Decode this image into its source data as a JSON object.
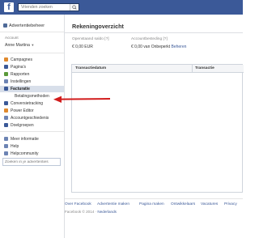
{
  "topbar": {
    "logo": "f",
    "search_placeholder": "Vrienden zoeken"
  },
  "sidebar": {
    "header": "Advertentiebeheer",
    "account_label": "Account",
    "account_name": "Anne Martina",
    "account_chevron": "▼",
    "items": [
      {
        "label": "Campagnes",
        "icon": "campaigns-icon",
        "color": "#e08a2e"
      },
      {
        "label": "Pagina's",
        "icon": "pages-icon",
        "color": "#3b5998"
      },
      {
        "label": "Rapporten",
        "icon": "reports-icon",
        "color": "#5b9a3a"
      },
      {
        "label": "Instellingen",
        "icon": "settings-icon",
        "color": "#6d84b4"
      },
      {
        "label": "Facturatie",
        "icon": "billing-icon",
        "color": "#3b5998"
      },
      {
        "label": "Betalingsmethoden",
        "icon": "",
        "color": ""
      },
      {
        "label": "Conversietracking",
        "icon": "conversion-icon",
        "color": "#3b5998"
      },
      {
        "label": "Power Editor",
        "icon": "power-editor-icon",
        "color": "#e08a2e"
      },
      {
        "label": "Accountgeschiedenis",
        "icon": "history-icon",
        "color": "#6d84b4"
      },
      {
        "label": "Doelgroepen",
        "icon": "audiences-icon",
        "color": "#3b5998"
      },
      {
        "label": "Meer informatie",
        "icon": "info-icon",
        "color": "#6d84b4"
      },
      {
        "label": "Help",
        "icon": "help-icon",
        "color": "#6d84b4"
      },
      {
        "label": "Helpcommunity",
        "icon": "community-icon",
        "color": "#6d84b4"
      }
    ],
    "search_placeholder": "Zoeken in je advertenties"
  },
  "main": {
    "title": "Rekeningoverzicht",
    "stats": [
      {
        "label": "Openstaand saldo [?]",
        "value": "€ 0,00 EUR"
      },
      {
        "label": "Accountbesteding [?]",
        "value": "€ 0,00 van Onbeperkt",
        "link": "Beheren"
      }
    ],
    "table_headers": [
      "Transactiedatum",
      "Transactie"
    ]
  },
  "footer": {
    "links": [
      "Over Facebook",
      "Advertentie maken",
      "Pagina maken",
      "Ontwikkelaars",
      "Vacatures",
      "Privacy"
    ],
    "copyright": "Facebook © 2014 ·",
    "language": "Nederlands"
  },
  "colors": {
    "brand": "#3b5998",
    "active_row": "#d8dfea",
    "arrow": "#d21c1c"
  }
}
